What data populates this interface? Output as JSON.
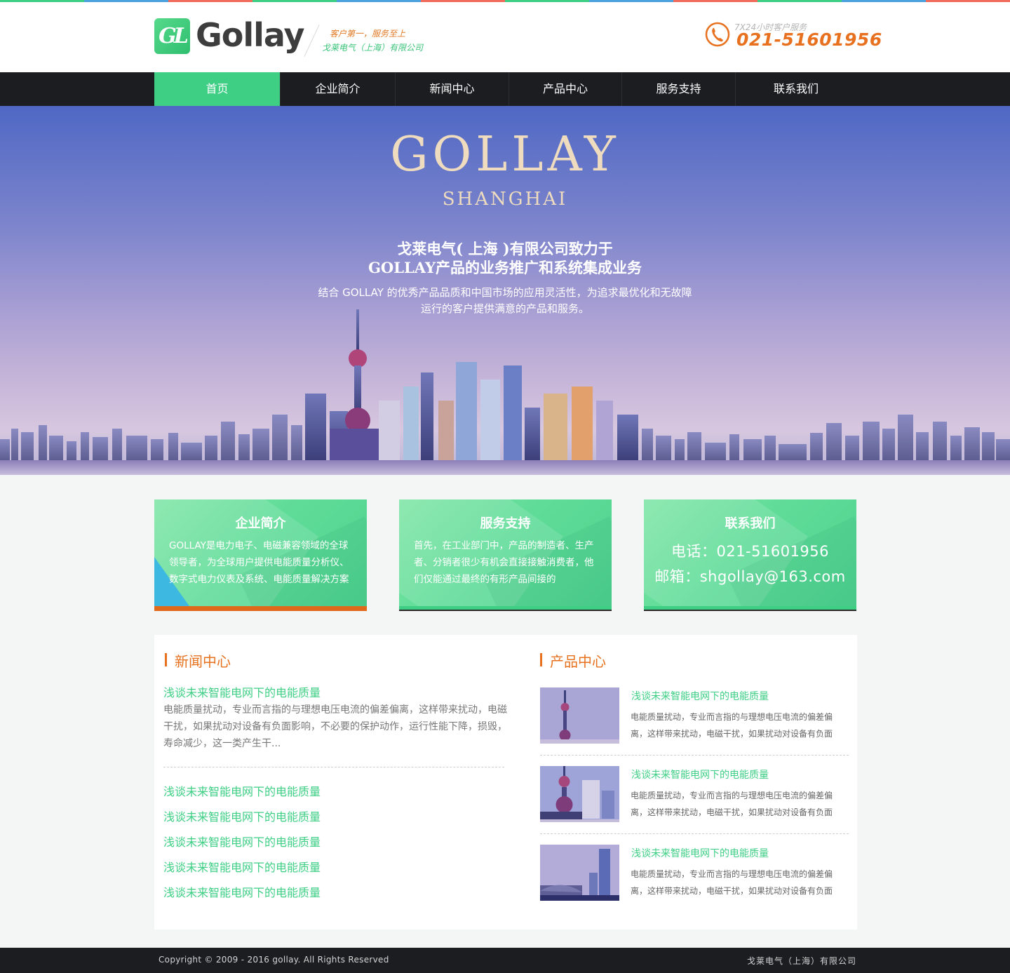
{
  "colors": {
    "accent_green": "#3ecf85",
    "accent_orange": "#e8711f",
    "nav_bg": "#1b1d20",
    "strip": [
      "#3ecf85",
      "#4aa3df",
      "#f06b5b",
      "#3ecf85",
      "#4aa3df",
      "#f06b5b",
      "#3ecf85",
      "#4aa3df",
      "#f06b5b",
      "#3ecf85",
      "#4aa3df",
      "#f06b5b"
    ]
  },
  "header": {
    "logo_mark": "GL",
    "logo_text": "Gollay",
    "slogan_line1": "客户第一，服务至上",
    "slogan_line2": "戈莱电气（上海）有限公司",
    "phone_icon": "phone-icon",
    "hotline_label": "7X24小时客户服务",
    "hotline_number": "021-51601956"
  },
  "nav": {
    "items": [
      {
        "label": "首页",
        "active": true
      },
      {
        "label": "企业简介",
        "active": false
      },
      {
        "label": "新闻中心",
        "active": false
      },
      {
        "label": "产品中心",
        "active": false
      },
      {
        "label": "服务支持",
        "active": false
      },
      {
        "label": "联系我们",
        "active": false
      }
    ]
  },
  "banner": {
    "title": "GOLLAY",
    "subtitle": "SHANGHAI",
    "headline_line1": "戈莱电气( 上海 )有限公司致力于",
    "headline_line2": "GOLLAY产品的业务推广和系统集成业务",
    "desc_line1": "结合 GOLLAY 的优秀产品品质和中国市场的应用灵活性，为追求最优化和无故障",
    "desc_line2": "运行的客户提供满意的产品和服务。"
  },
  "features": [
    {
      "title": "企业简介",
      "text": "GOLLAY是电力电子、电磁兼容领域的全球领导者，为全球用户提供电能质量分析仪、数字式电力仪表及系统、电能质量解决方案"
    },
    {
      "title": "服务支持",
      "text": "首先，在工业部门中，产品的制造者、生产者、分销者很少有机会直接接触消费者，他们仅能通过最终的有形产品间接的"
    },
    {
      "title": "联系我们",
      "phone_line": "电话：021-51601956",
      "email_line": "邮箱：shgollay@163.com"
    }
  ],
  "news": {
    "section_title": "新闻中心",
    "featured": {
      "title": "浅谈未来智能电网下的电能质量",
      "summary": "电能质量扰动，专业而言指的与理想电压电流的偏差偏离，这样带来扰动，电磁干扰，如果扰动对设备有负面影响，不必要的保护动作，运行性能下降，损毁，寿命减少，这一类产生干..."
    },
    "items": [
      "浅谈未来智能电网下的电能质量",
      "浅谈未来智能电网下的电能质量",
      "浅谈未来智能电网下的电能质量",
      "浅谈未来智能电网下的电能质量",
      "浅谈未来智能电网下的电能质量"
    ]
  },
  "products": {
    "section_title": "产品中心",
    "items": [
      {
        "title": "浅谈未来智能电网下的电能质量",
        "text": "电能质量扰动，专业而言指的与理想电压电流的偏差偏离，这样带来扰动，电磁干扰，如果扰动对设备有负面"
      },
      {
        "title": "浅谈未来智能电网下的电能质量",
        "text": "电能质量扰动，专业而言指的与理想电压电流的偏差偏离，这样带来扰动，电磁干扰，如果扰动对设备有负面"
      },
      {
        "title": "浅谈未来智能电网下的电能质量",
        "text": "电能质量扰动，专业而言指的与理想电压电流的偏差偏离，这样带来扰动，电磁干扰，如果扰动对设备有负面"
      }
    ]
  },
  "footer": {
    "copyright": "Copyright © 2009 - 2016 gollay. All Rights Reserved",
    "company": "戈莱电气（上海）有限公司"
  }
}
